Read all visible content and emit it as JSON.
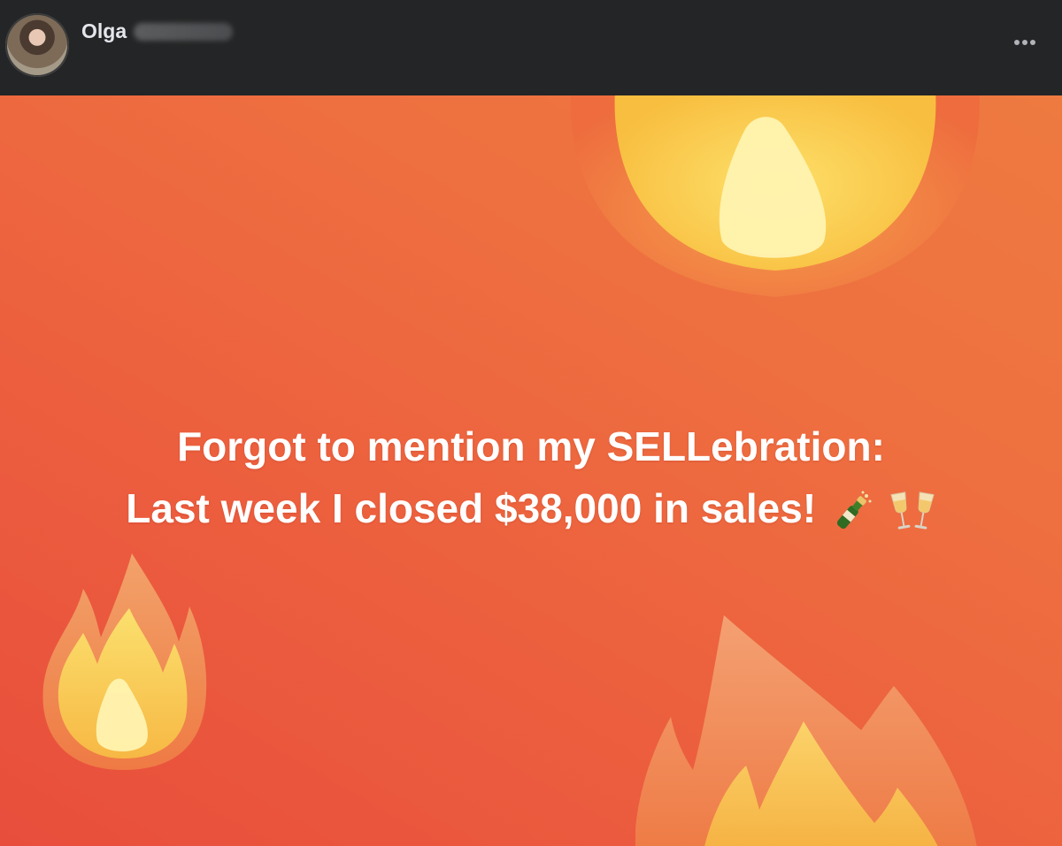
{
  "post": {
    "author_name": "Olga",
    "line1": "Forgot to mention my SELLebration:",
    "line2": "Last week I closed $38,000 in sales!"
  },
  "icons": {
    "avatar": "profile-photo",
    "more": "more-options-icon",
    "emojis": [
      "champagne-bottle-icon",
      "clinking-glasses-icon"
    ],
    "decorations": [
      "fire-icon",
      "fire-icon",
      "fire-icon"
    ]
  },
  "colors": {
    "header_bg": "#242526",
    "author_text": "#e4e6eb",
    "card_bg_start": "#e84e3c",
    "card_bg_end": "#ee7a40",
    "flame_outer": "#f07a45",
    "flame_inner": "#fbd14b",
    "flame_core": "#fff3b0"
  }
}
